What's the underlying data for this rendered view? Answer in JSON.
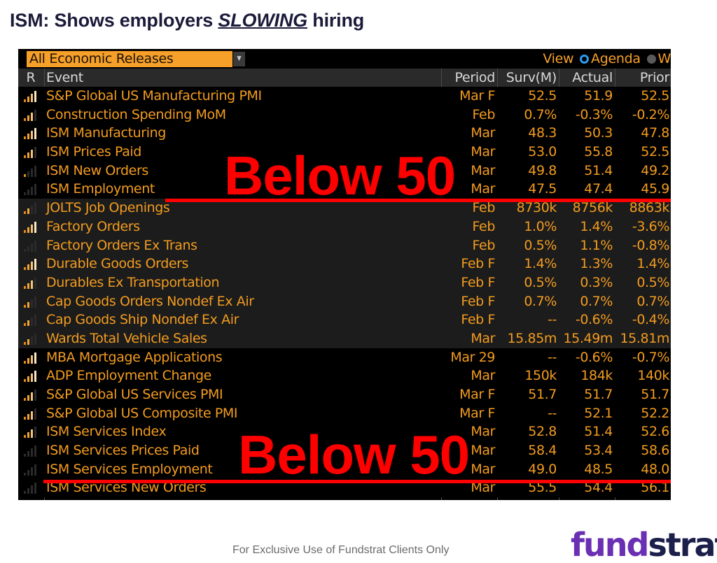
{
  "slide": {
    "title_prefix": "ISM: Shows employers ",
    "title_emphasis": "SLOWING",
    "title_suffix": " hiring",
    "footer_note": "For Exclusive Use of Fundstrat Clients Only",
    "logo_part1": "fund",
    "logo_part2": "strat"
  },
  "toolbar": {
    "dropdown_value": "All Economic Releases",
    "dropdown_arrow": "▼",
    "view_label": "View",
    "view_options": [
      {
        "label": "Agenda",
        "selected": true
      },
      {
        "label": "W",
        "selected": false
      }
    ]
  },
  "table": {
    "headers": {
      "r": "R",
      "event": "Event",
      "period": "Period",
      "surv": "Surv(M)",
      "actual": "Actual",
      "prior": "Prior"
    },
    "rows": [
      {
        "relevance": 4,
        "event": "S&P Global US Manufacturing PMI",
        "period": "Mar F",
        "surv": "52.5",
        "actual": "51.9",
        "prior": "52.5",
        "group": "black"
      },
      {
        "relevance": 3,
        "event": "Construction Spending MoM",
        "period": "Feb",
        "surv": "0.7%",
        "actual": "-0.3%",
        "prior": "-0.2%",
        "group": "black"
      },
      {
        "relevance": 4,
        "event": "ISM Manufacturing",
        "period": "Mar",
        "surv": "48.3",
        "actual": "50.3",
        "prior": "47.8",
        "group": "black"
      },
      {
        "relevance": 3,
        "event": "ISM Prices Paid",
        "period": "Mar",
        "surv": "53.0",
        "actual": "55.8",
        "prior": "52.5",
        "group": "black"
      },
      {
        "relevance": 1,
        "event": "ISM New Orders",
        "period": "Mar",
        "surv": "49.8",
        "actual": "51.4",
        "prior": "49.2",
        "group": "black"
      },
      {
        "relevance": 0,
        "event": "ISM Employment",
        "period": "Mar",
        "surv": "47.5",
        "actual": "47.4",
        "prior": "45.9",
        "group": "black"
      },
      {
        "relevance": 2,
        "event": "JOLTS Job Openings",
        "period": "Feb",
        "surv": "8730k",
        "actual": "8756k",
        "prior": "8863k",
        "group": "gray"
      },
      {
        "relevance": 4,
        "event": "Factory Orders",
        "period": "Feb",
        "surv": "1.0%",
        "actual": "1.4%",
        "prior": "-3.6%",
        "group": "gray"
      },
      {
        "relevance": 0,
        "event": "Factory Orders Ex Trans",
        "period": "Feb",
        "surv": "0.5%",
        "actual": "1.1%",
        "prior": "-0.8%",
        "group": "gray"
      },
      {
        "relevance": 4,
        "event": "Durable Goods Orders",
        "period": "Feb F",
        "surv": "1.4%",
        "actual": "1.3%",
        "prior": "1.4%",
        "group": "gray"
      },
      {
        "relevance": 3,
        "event": "Durables Ex Transportation",
        "period": "Feb F",
        "surv": "0.5%",
        "actual": "0.3%",
        "prior": "0.5%",
        "group": "gray"
      },
      {
        "relevance": 2,
        "event": "Cap Goods Orders Nondef Ex Air",
        "period": "Feb F",
        "surv": "0.7%",
        "actual": "0.7%",
        "prior": "0.7%",
        "group": "gray"
      },
      {
        "relevance": 2,
        "event": "Cap Goods Ship Nondef Ex Air",
        "period": "Feb F",
        "surv": "--",
        "actual": "-0.6%",
        "prior": "-0.4%",
        "group": "gray"
      },
      {
        "relevance": 2,
        "event": "Wards Total Vehicle Sales",
        "period": "Mar",
        "surv": "15.85m",
        "actual": "15.49m",
        "prior": "15.81m",
        "group": "gray"
      },
      {
        "relevance": 4,
        "event": "MBA Mortgage Applications",
        "period": "Mar 29",
        "surv": "--",
        "actual": "-0.6%",
        "prior": "-0.7%",
        "group": "black"
      },
      {
        "relevance": 4,
        "event": "ADP Employment Change",
        "period": "Mar",
        "surv": "150k",
        "actual": "184k",
        "prior": "140k",
        "group": "black"
      },
      {
        "relevance": 3,
        "event": "S&P Global US Services PMI",
        "period": "Mar F",
        "surv": "51.7",
        "actual": "51.7",
        "prior": "51.7",
        "group": "black"
      },
      {
        "relevance": 3,
        "event": "S&P Global US Composite PMI",
        "period": "Mar F",
        "surv": "--",
        "actual": "52.1",
        "prior": "52.2",
        "group": "black"
      },
      {
        "relevance": 3,
        "event": "ISM Services Index",
        "period": "Mar",
        "surv": "52.8",
        "actual": "51.4",
        "prior": "52.6",
        "group": "black"
      },
      {
        "relevance": 0,
        "event": "ISM Services Prices Paid",
        "period": "Mar",
        "surv": "58.4",
        "actual": "53.4",
        "prior": "58.6",
        "group": "black"
      },
      {
        "relevance": 0,
        "event": "ISM Services Employment",
        "period": "Mar",
        "surv": "49.0",
        "actual": "48.5",
        "prior": "48.0",
        "group": "black"
      },
      {
        "relevance": 0,
        "event": "ISM Services New Orders",
        "period": "Mar",
        "surv": "55.5",
        "actual": "54.4",
        "prior": "56.1",
        "group": "black"
      }
    ]
  },
  "annotations": {
    "callout_top": "Below 50",
    "callout_bottom": "Below 50",
    "color": "#ff0000"
  }
}
